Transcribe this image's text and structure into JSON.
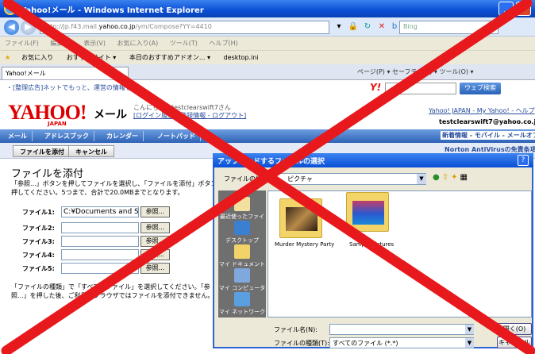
{
  "window": {
    "title": "Yahoo!メール - Windows Internet Explorer"
  },
  "address": {
    "url_prefix": "http://jp.f43.mail.",
    "url_host": "yahoo.co.jp",
    "url_path": "/ym/Compose?YY=4410",
    "search_placeholder": "Bing"
  },
  "menu": [
    "ファイル(F)",
    "編集(E)",
    "表示(V)",
    "お気に入り(A)",
    "ツール(T)",
    "ヘルプ(H)"
  ],
  "favorites": {
    "label": "お気に入り",
    "items": [
      "おすすめサイト ▾",
      "本日のおすすめアドオン... ▾",
      "desktop.ini"
    ]
  },
  "tab": {
    "label": "Yahoo!メール",
    "tools": "ページ(P) ▾  セーフティ(S) ▾  ツール(O) ▾"
  },
  "yahoo": {
    "ad_line": "・[整理広告]ネットでもっと、運営の情報を",
    "web_search": "ウェブ検索",
    "logo": "YAHOO!",
    "logo_sub": "JAPAN",
    "mail": "メール",
    "greeting_line1": "こんにちは、testclearswift7さん",
    "greeting_line2": "[ログイン履歴 - 登録情報 - ログアウト]",
    "top_links": "Yahoo! JAPAN - My Yahoo! - ヘルプ",
    "user_email": "testclearswift7@yahoo.co.jp",
    "nav_tabs": [
      "メール",
      "アドレスブック",
      "カレンダー",
      "ノートパッド"
    ],
    "sub_links": "新着情報 - モバイル - メールオプション",
    "attach_button": "ファイルを添付",
    "cancel_button": "キャンセル",
    "norton": "Norton AntiVirusの免責条項"
  },
  "attach": {
    "title": "ファイルを添付",
    "desc": "「参照...」ボタンを押してファイルを選択し、「ファイルを添付」ボタンを押してください。5つまで、合計で20.0MBまでとなります。",
    "rows": [
      {
        "label": "ファイル1:",
        "value": "C:¥Documents and Settings"
      },
      {
        "label": "ファイル2:",
        "value": ""
      },
      {
        "label": "ファイル3:",
        "value": ""
      },
      {
        "label": "ファイル4:",
        "value": ""
      },
      {
        "label": "ファイル5:",
        "value": ""
      }
    ],
    "browse": "参照...",
    "help": "「ファイルの種類」で「すべてのファイル」を選択してください。「参照...」を押した後、ご利用のブラウザではファイルを添付できません。"
  },
  "dialog": {
    "title": "アップロードするファイルの選択",
    "look_in_label": "ファイルの場所(I):",
    "look_in_value": "ピクチャ",
    "places": [
      "最近使ったファイル",
      "デスクトップ",
      "マイ ドキュメント",
      "マイ コンピュータ",
      "マイ ネットワーク"
    ],
    "folders": [
      "Murder Mystery Party",
      "Sample Pictures"
    ],
    "file_name_label": "ファイル名(N):",
    "file_name_value": "",
    "file_type_label": "ファイルの種類(T):",
    "file_type_value": "すべてのファイル (*.*)",
    "open_button": "開く(O)",
    "cancel_button": "キャンセル"
  },
  "overlay": {
    "color": "#e8191c"
  }
}
